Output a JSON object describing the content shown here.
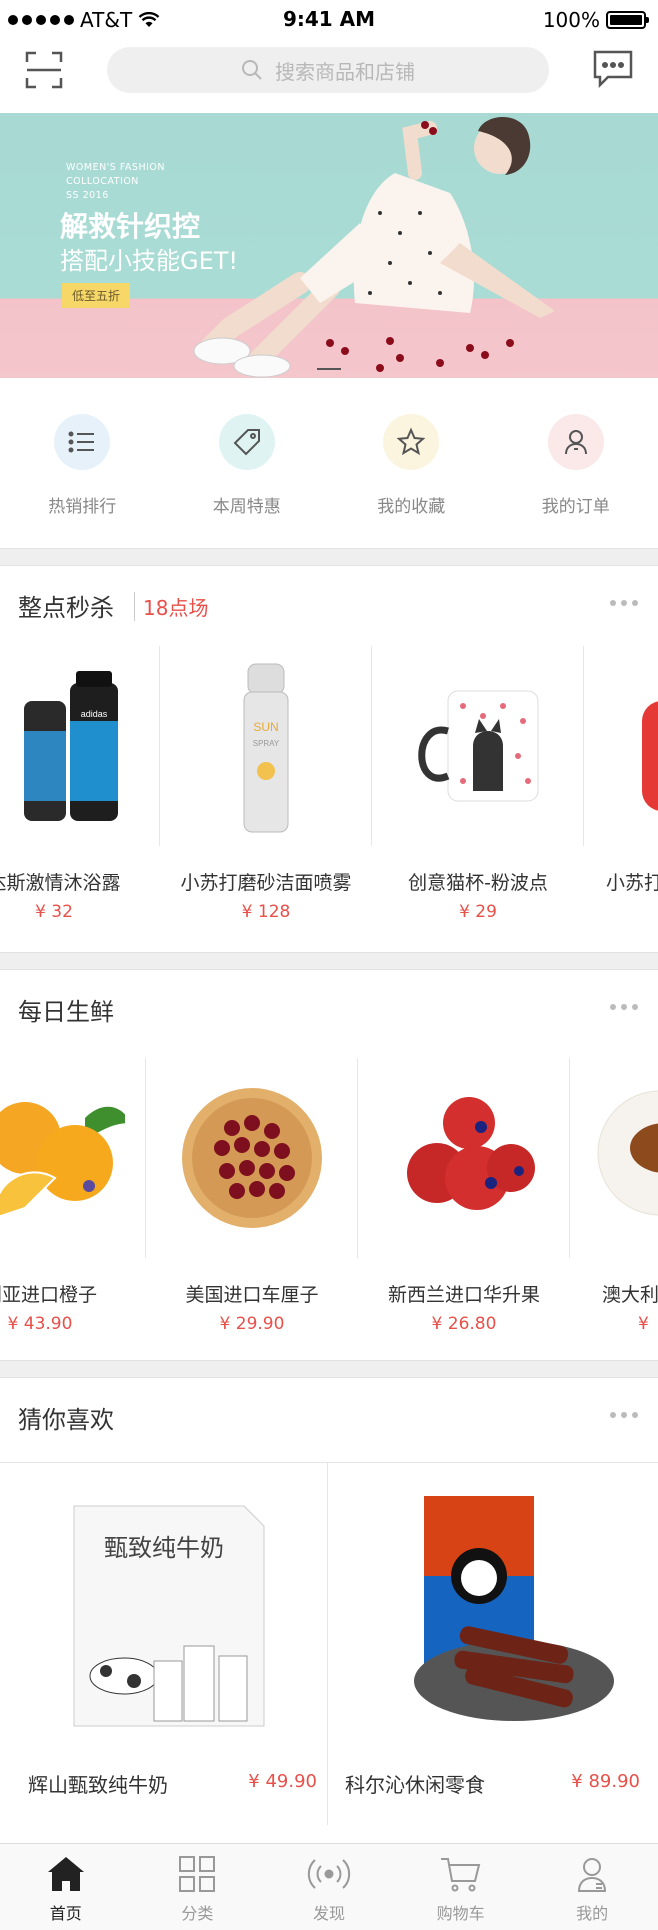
{
  "status_bar": {
    "carrier": "AT&T",
    "time": "9:41 AM",
    "battery": "100%",
    "battery_level": 1.0
  },
  "header": {
    "search_placeholder": "搜索商品和店铺",
    "scan_icon": "scan-icon",
    "message_icon": "message-icon"
  },
  "banner": {
    "small_lines": [
      "WOMEN'S FASHION",
      "COLLOCATION",
      "SS 2016"
    ],
    "headline": "解救针织控",
    "subline": "搭配小技能GET!",
    "tag": "低至五折"
  },
  "quick_nav": [
    {
      "label": "热销排行",
      "icon": "list-icon",
      "color": "#e7f1fa"
    },
    {
      "label": "本周特惠",
      "icon": "price-tag-icon",
      "color": "#dff4f2"
    },
    {
      "label": "我的收藏",
      "icon": "star-icon",
      "color": "#fbf4df"
    },
    {
      "label": "我的订单",
      "icon": "user-order-icon",
      "color": "#fbe9ea"
    }
  ],
  "flash_sale": {
    "title": "整点秒杀",
    "session": "18点场",
    "items": [
      {
        "name": "达斯激情沐浴露",
        "price": "¥ 32"
      },
      {
        "name": "小苏打磨砂洁面喷雾",
        "price": "¥ 128"
      },
      {
        "name": "创意猫杯-粉波点",
        "price": "¥ 29"
      },
      {
        "name": "小苏打",
        "price": ""
      }
    ]
  },
  "fresh": {
    "title": "每日生鲜",
    "items": [
      {
        "name": "利亚进口橙子",
        "price": "¥ 43.90"
      },
      {
        "name": "美国进口车厘子",
        "price": "¥ 29.90"
      },
      {
        "name": "新西兰进口华升果",
        "price": "¥ 26.80"
      },
      {
        "name": "澳大利",
        "price": "¥"
      }
    ]
  },
  "guess": {
    "title": "猜你喜欢",
    "items": [
      {
        "name": "辉山甄致纯牛奶",
        "price": "¥ 49.90",
        "box_text": "甄致纯牛奶"
      },
      {
        "name": "科尔沁休闲零食",
        "price": "¥ 89.90"
      }
    ]
  },
  "tabbar": [
    {
      "label": "首页",
      "icon": "home-icon",
      "active": true
    },
    {
      "label": "分类",
      "icon": "category-grid-icon",
      "active": false
    },
    {
      "label": "发现",
      "icon": "discover-broadcast-icon",
      "active": false
    },
    {
      "label": "购物车",
      "icon": "cart-icon",
      "active": false
    },
    {
      "label": "我的",
      "icon": "profile-icon",
      "active": false
    }
  ],
  "colors": {
    "accent_red": "#e8504a",
    "banner_teal": "#a8dad3",
    "banner_pink": "#f4c7cd"
  }
}
